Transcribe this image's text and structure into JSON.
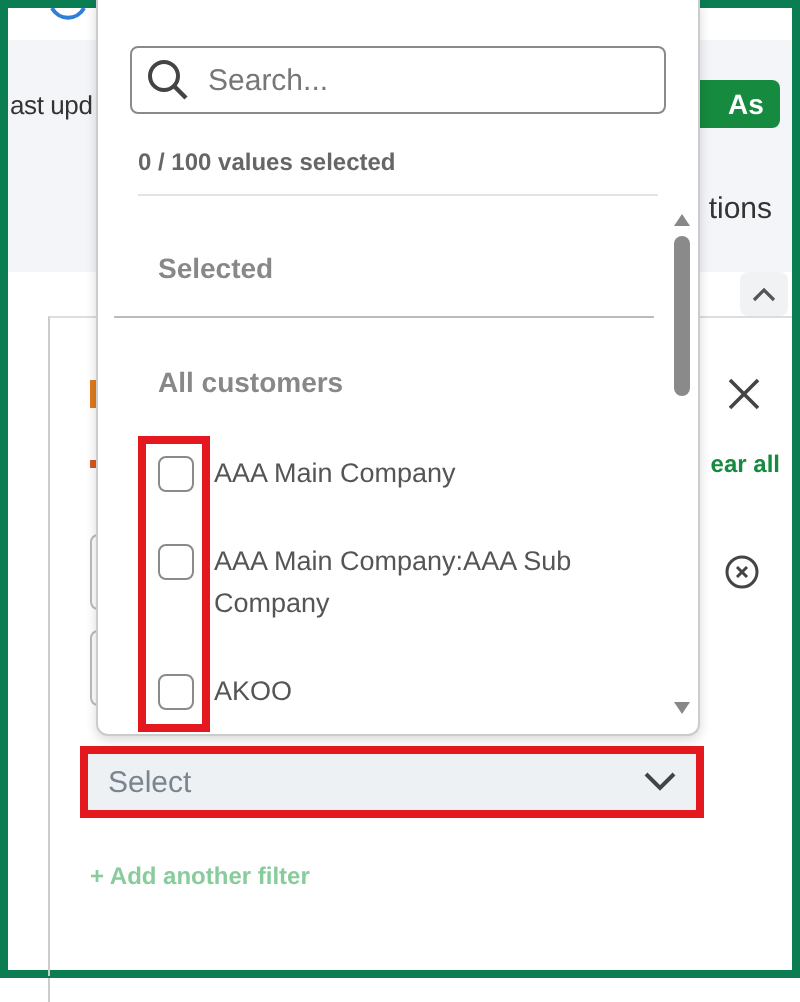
{
  "background": {
    "header_text": "ast upd",
    "save_button": "As",
    "options_text": "tions",
    "clear_all_link": "ear all",
    "select_field": {
      "placeholder": "Select"
    },
    "add_filter_link": "+ Add another filter"
  },
  "dropdown": {
    "search": {
      "placeholder": "Search..."
    },
    "count": "0 / 100 values selected",
    "selected_heading": "Selected",
    "all_heading": "All customers",
    "items": [
      {
        "label": "AAA Main Company",
        "checked": false
      },
      {
        "label": "AAA Main Company:AAA Sub Company",
        "checked": false
      },
      {
        "label": "AKOO",
        "checked": false
      }
    ]
  }
}
